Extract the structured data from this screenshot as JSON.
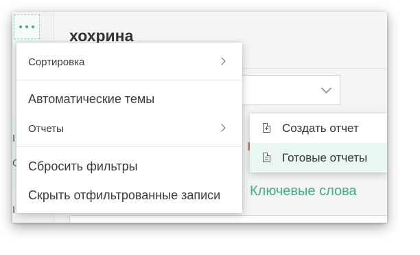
{
  "app": {
    "title": "хохрина",
    "more_button_icon": "more-dots-icon",
    "rail_chars": [
      "I",
      "О",
      "I"
    ],
    "keywords_tab": "Ключевые слова"
  },
  "menu": {
    "items": [
      {
        "label": "Сортировка",
        "has_submenu": true
      },
      {
        "label": "Автоматические темы",
        "has_submenu": false
      },
      {
        "label": "Отчеты",
        "has_submenu": true
      },
      {
        "label": "Сбросить фильтры",
        "has_submenu": false
      },
      {
        "label": "Скрыть отфильтрованные записи",
        "has_submenu": false
      }
    ]
  },
  "submenu": {
    "items": [
      {
        "label": "Создать отчет",
        "icon": "document-plus-icon",
        "active": false
      },
      {
        "label": "Готовые отчеты",
        "icon": "document-lines-icon",
        "active": true
      }
    ]
  },
  "colors": {
    "accent": "#3fae82",
    "active_bg": "#eaf6f0"
  }
}
